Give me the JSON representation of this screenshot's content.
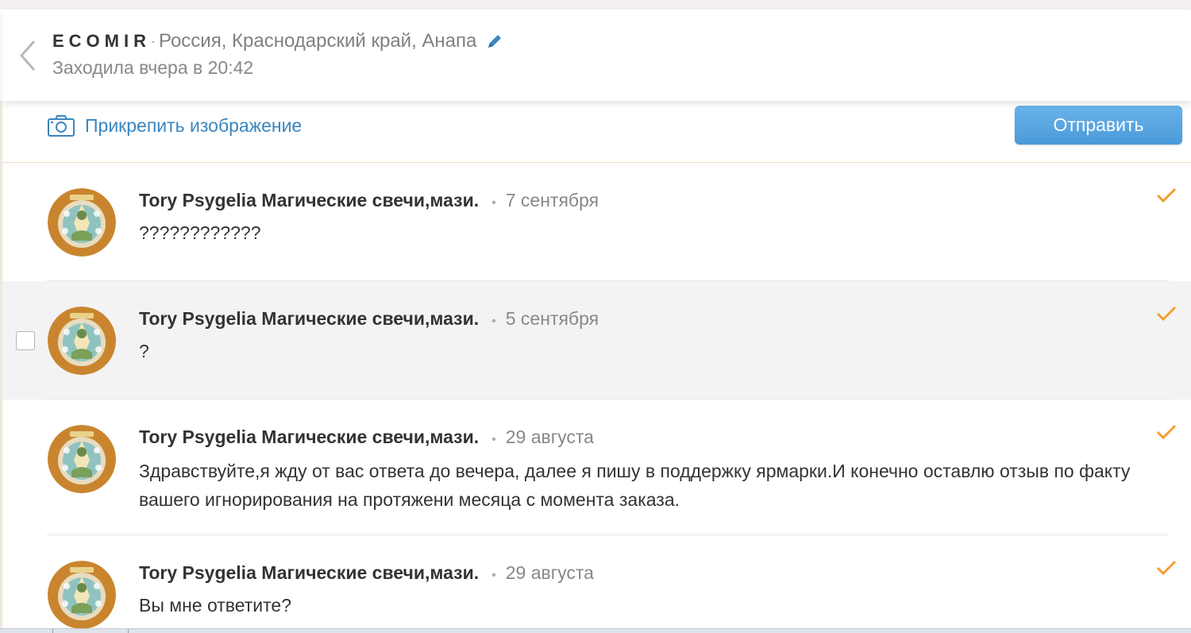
{
  "header": {
    "shop_name": "ECOMIR",
    "separator": "·",
    "location": "Россия, Краснодарский край, Анапа",
    "last_seen": "Заходила вчера в 20:42"
  },
  "composer": {
    "attach_label": "Прикрепить изображение",
    "send_label": "Отправить"
  },
  "colors": {
    "accent": "#3a86bf",
    "send_button": "#5aa7e3",
    "check": "#f0a030",
    "highlight_row": "#f3f3f3"
  },
  "icons": {
    "back": "chevron-left-icon",
    "edit": "pencil-icon",
    "attach": "camera-icon",
    "read": "checkmark-icon"
  },
  "messages": [
    {
      "author": "Tory Psygelia Магические свечи,мази.",
      "dot": "•",
      "date": "7 сентября",
      "text": "????????????",
      "highlighted": false
    },
    {
      "author": "Tory Psygelia Магические свечи,мази.",
      "dot": "•",
      "date": "5 сентября",
      "text": "?",
      "highlighted": true
    },
    {
      "author": "Tory Psygelia Магические свечи,мази.",
      "dot": "•",
      "date": "29 августа",
      "text": "Здравствуйте,я жду от вас ответа до вечера, далее я пишу в поддержку ярмарки.И конечно оставлю отзыв по факту вашего игнорирования на протяжени месяца с момента заказа.",
      "highlighted": false
    },
    {
      "author": "Tory Psygelia Магические свечи,мази.",
      "dot": "•",
      "date": "29 августа",
      "text": "Вы мне ответите?",
      "highlighted": false
    }
  ]
}
